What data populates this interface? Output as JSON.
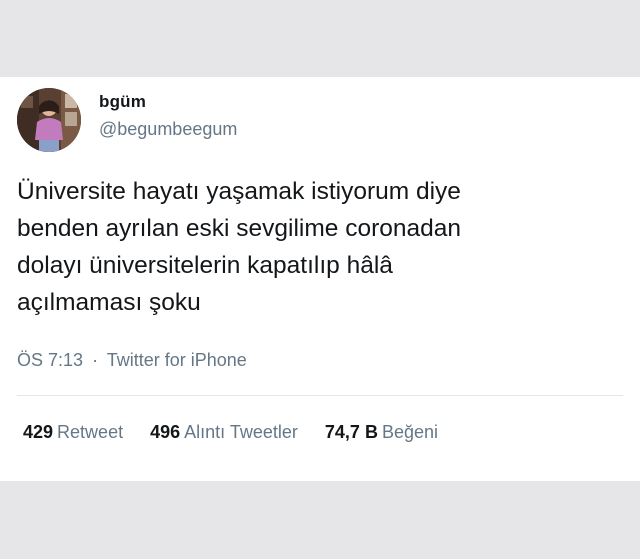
{
  "tweet": {
    "display_name": "bgüm",
    "handle": "@begumbeegum",
    "text": "Üniversite hayatı yaşamak istiyorum diye\nbenden ayrılan eski sevgilime coronadan\ndolayı üniversitelerin kapatılıp hâlâ\naçılmaması şoku",
    "time": "ÖS 7:13",
    "separator": "·",
    "source": "Twitter for iPhone"
  },
  "stats": [
    {
      "count": "429",
      "label": "Retweet"
    },
    {
      "count": "496",
      "label": "Alıntı Tweetler"
    },
    {
      "count": "74,7 B",
      "label": "Beğeni"
    }
  ],
  "colors": {
    "background": "#e6e6e8",
    "card": "#ffffff",
    "text_primary": "#14171a",
    "text_secondary": "#657786"
  }
}
